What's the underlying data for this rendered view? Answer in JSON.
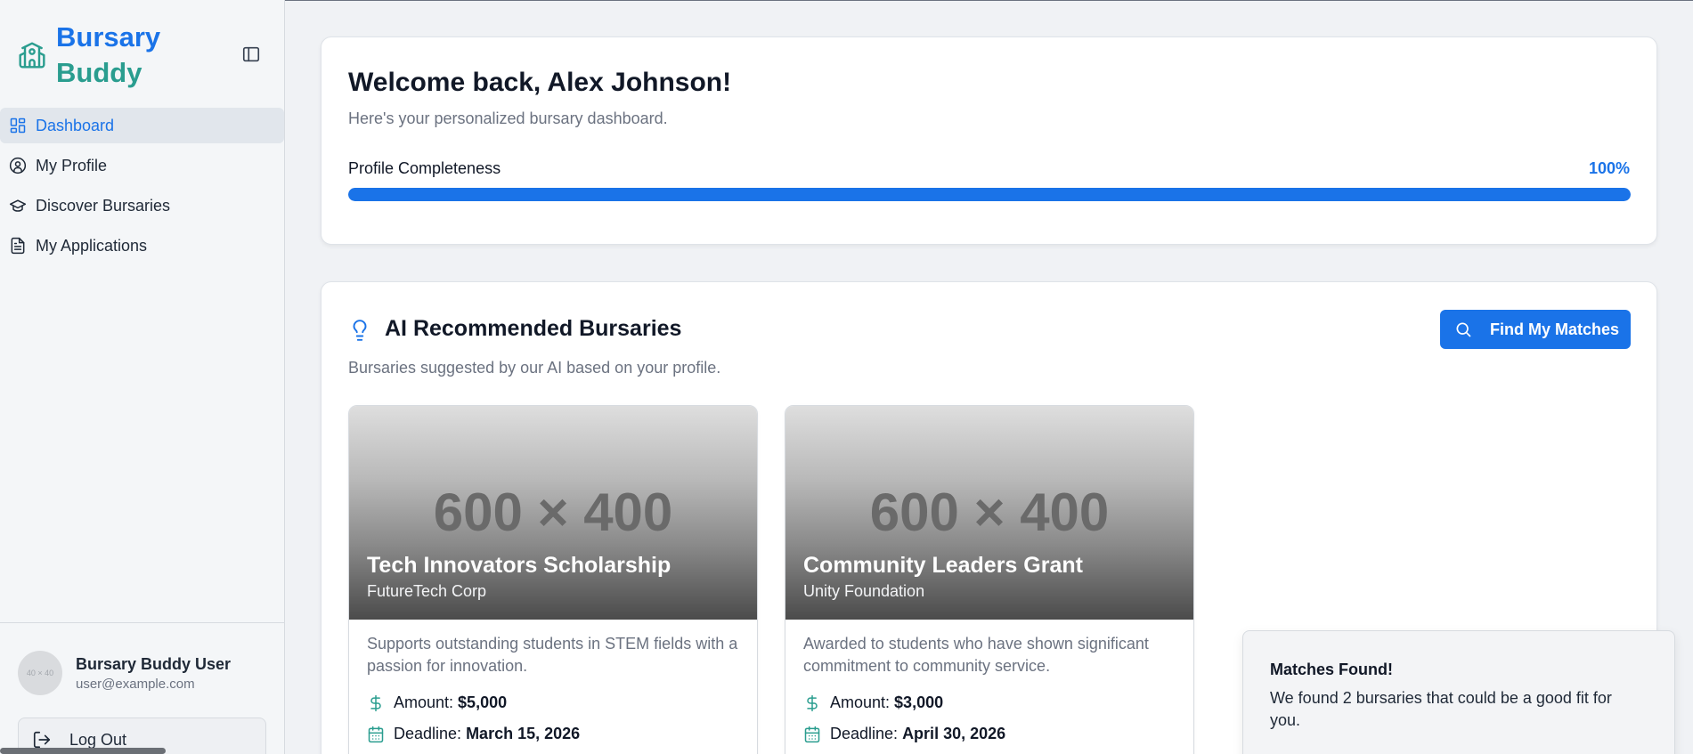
{
  "app": {
    "brand_line1": "Bursary",
    "brand_line2": "Buddy"
  },
  "sidebar": {
    "items": [
      {
        "label": "Dashboard",
        "icon": "dashboard-icon",
        "active": true
      },
      {
        "label": "My Profile",
        "icon": "user-circle-icon"
      },
      {
        "label": "Discover Bursaries",
        "icon": "graduation-cap-icon"
      },
      {
        "label": "My Applications",
        "icon": "document-icon"
      }
    ],
    "user": {
      "avatar_text": "40 × 40",
      "name": "Bursary Buddy User",
      "email": "user@example.com"
    },
    "logout_label": "Log Out"
  },
  "welcome": {
    "title": "Welcome back, Alex Johnson!",
    "subtitle": "Here's your personalized bursary dashboard.",
    "profile_label": "Profile Completeness",
    "profile_value_text": "100%",
    "profile_value": 1.0
  },
  "recommended": {
    "title": "AI Recommended Bursaries",
    "subtitle": "Bursaries suggested by our AI based on your profile.",
    "find_button": "Find My Matches",
    "bursaries": [
      {
        "image_placeholder": "600 × 400",
        "title": "Tech Innovators Scholarship",
        "org": "FutureTech Corp",
        "description": "Supports outstanding students in STEM fields with a passion for innovation.",
        "amount_label": "Amount:",
        "amount": "$5,000",
        "deadline_label": "Deadline:",
        "deadline": "March 15, 2026"
      },
      {
        "image_placeholder": "600 × 400",
        "title": "Community Leaders Grant",
        "org": "Unity Foundation",
        "description": "Awarded to students who have shown significant commitment to community service.",
        "amount_label": "Amount:",
        "amount": "$3,000",
        "deadline_label": "Deadline:",
        "deadline": "April 30, 2026"
      }
    ]
  },
  "toast": {
    "title": "Matches Found!",
    "body": "We found 2 bursaries that could be a good fit for you."
  },
  "colors": {
    "primary": "#1a73e8",
    "teal": "#2a9d8f"
  }
}
